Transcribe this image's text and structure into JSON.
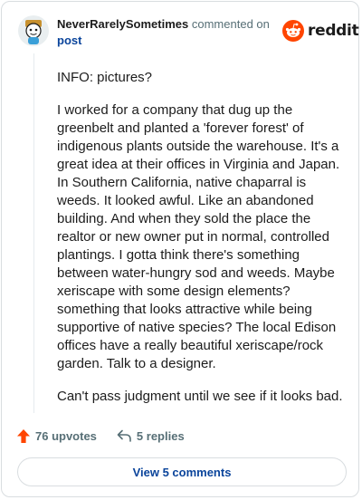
{
  "comment": {
    "author": "NeverRarelySometimes",
    "action_text": "commented on",
    "target": "post",
    "paragraphs": [
      "INFO: pictures?",
      "I worked for a company that dug up the greenbelt and planted a 'forever forest' of indigenous plants outside the warehouse. It's a great idea at their offices in Virginia and Japan. In Southern California, native chaparral is weeds. It looked awful. Like an abandoned building. And when they sold the place the realtor or new owner put in normal, controlled plantings. I gotta think there's something between water-hungry sod and weeds. Maybe xeriscape with some design elements? something that looks attractive while being supportive of native species? The local Edison offices have a really beautiful xeriscape/rock garden. Talk to a designer.",
      "Can't pass judgment until we see if it looks bad."
    ],
    "upvotes": "76 upvotes",
    "replies": "5 replies"
  },
  "brand": {
    "name": "reddit",
    "accent": "#ff4500"
  },
  "footer": {
    "view_comments_label": "View 5 comments"
  },
  "icons": {
    "upvote": "upvote-arrow-icon",
    "reply": "reply-arrow-icon",
    "logo": "reddit-snoo-icon",
    "avatar": "user-avatar"
  }
}
